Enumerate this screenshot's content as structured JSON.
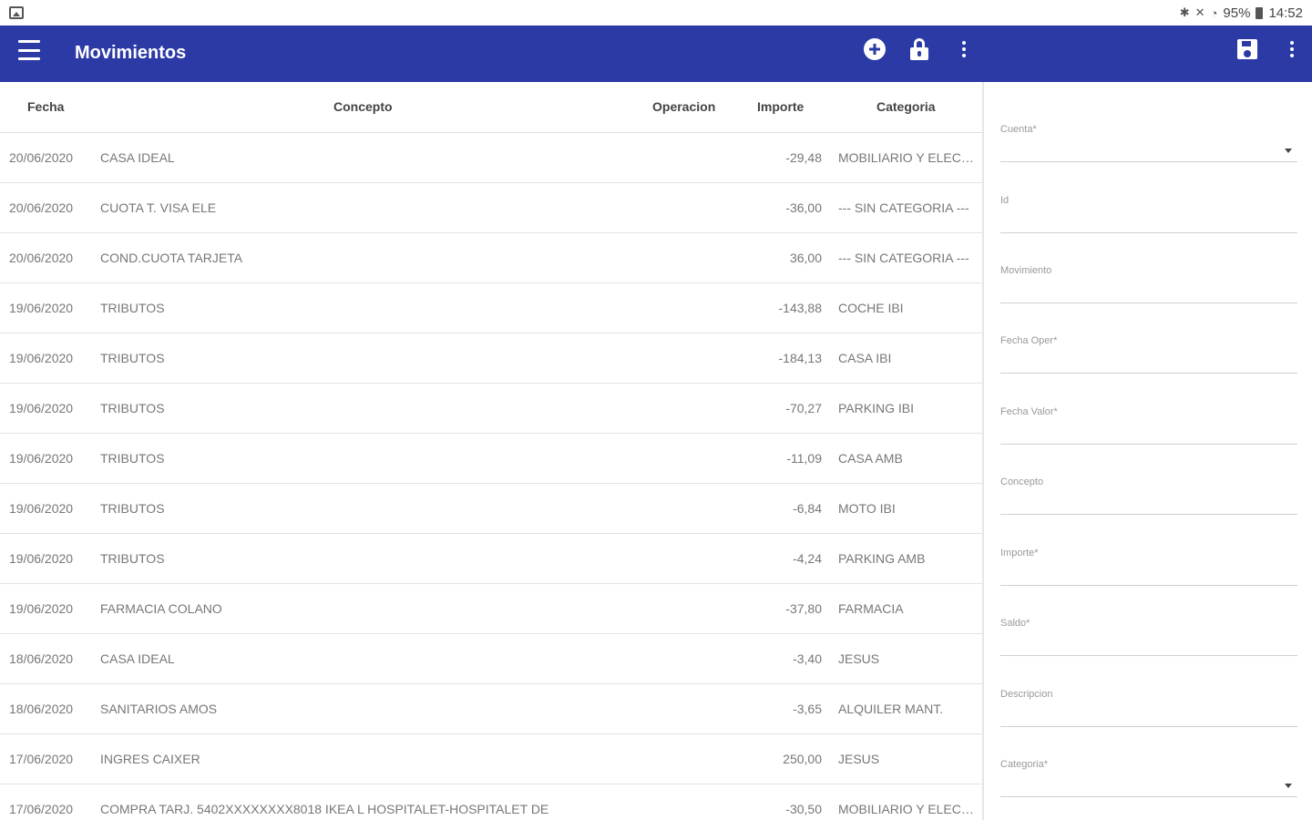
{
  "status_bar": {
    "battery": "95%",
    "time": "14:52"
  },
  "app_bar": {
    "title": "Movimientos",
    "icons": [
      "menu-icon",
      "add-circle-icon",
      "lock-icon",
      "more-vert-icon",
      "save-icon",
      "more-vert-icon"
    ]
  },
  "colors": {
    "primary": "#2c3aa6"
  },
  "table": {
    "headers": {
      "fecha": "Fecha",
      "concepto": "Concepto",
      "operacion": "Operacion",
      "importe": "Importe",
      "categoria": "Categoria"
    },
    "rows": [
      {
        "fecha": "20/06/2020",
        "concepto": "CASA IDEAL",
        "importe": "-29,48",
        "categoria": "MOBILIARIO Y ELECT..."
      },
      {
        "fecha": "20/06/2020",
        "concepto": "CUOTA T. VISA ELE",
        "importe": "-36,00",
        "categoria": "--- SIN CATEGORIA ---"
      },
      {
        "fecha": "20/06/2020",
        "concepto": "COND.CUOTA TARJETA",
        "importe": "36,00",
        "categoria": "--- SIN CATEGORIA ---"
      },
      {
        "fecha": "19/06/2020",
        "concepto": "TRIBUTOS",
        "importe": "-143,88",
        "categoria": "COCHE IBI"
      },
      {
        "fecha": "19/06/2020",
        "concepto": "TRIBUTOS",
        "importe": "-184,13",
        "categoria": "CASA IBI"
      },
      {
        "fecha": "19/06/2020",
        "concepto": "TRIBUTOS",
        "importe": "-70,27",
        "categoria": "PARKING IBI"
      },
      {
        "fecha": "19/06/2020",
        "concepto": "TRIBUTOS",
        "importe": "-11,09",
        "categoria": "CASA AMB"
      },
      {
        "fecha": "19/06/2020",
        "concepto": "TRIBUTOS",
        "importe": "-6,84",
        "categoria": "MOTO IBI"
      },
      {
        "fecha": "19/06/2020",
        "concepto": "TRIBUTOS",
        "importe": "-4,24",
        "categoria": "PARKING AMB"
      },
      {
        "fecha": "19/06/2020",
        "concepto": "FARMACIA COLANO",
        "importe": "-37,80",
        "categoria": "FARMACIA"
      },
      {
        "fecha": "18/06/2020",
        "concepto": "CASA IDEAL",
        "importe": "-3,40",
        "categoria": "JESUS"
      },
      {
        "fecha": "18/06/2020",
        "concepto": "SANITARIOS AMOS",
        "importe": "-3,65",
        "categoria": "ALQUILER MANT."
      },
      {
        "fecha": "17/06/2020",
        "concepto": "INGRES CAIXER",
        "importe": "250,00",
        "categoria": "JESUS"
      },
      {
        "fecha": "17/06/2020",
        "concepto": "COMPRA TARJ. 5402XXXXXXXX8018 IKEA L HOSPITALET-HOSPITALET DE",
        "importe": "-30,50",
        "categoria": "MOBILIARIO Y ELECT..."
      }
    ]
  },
  "form": {
    "fields": [
      {
        "label": "Cuenta*",
        "dropdown": true
      },
      {
        "label": "Id",
        "dropdown": false
      },
      {
        "label": "Movimiento",
        "dropdown": false
      },
      {
        "label": "Fecha Oper*",
        "dropdown": false
      },
      {
        "label": "Fecha Valor*",
        "dropdown": false
      },
      {
        "label": "Concepto",
        "dropdown": false
      },
      {
        "label": "Importe*",
        "dropdown": false
      },
      {
        "label": "Saldo*",
        "dropdown": false
      },
      {
        "label": "Descripcion",
        "dropdown": false
      },
      {
        "label": "Categoria*",
        "dropdown": true
      }
    ]
  }
}
